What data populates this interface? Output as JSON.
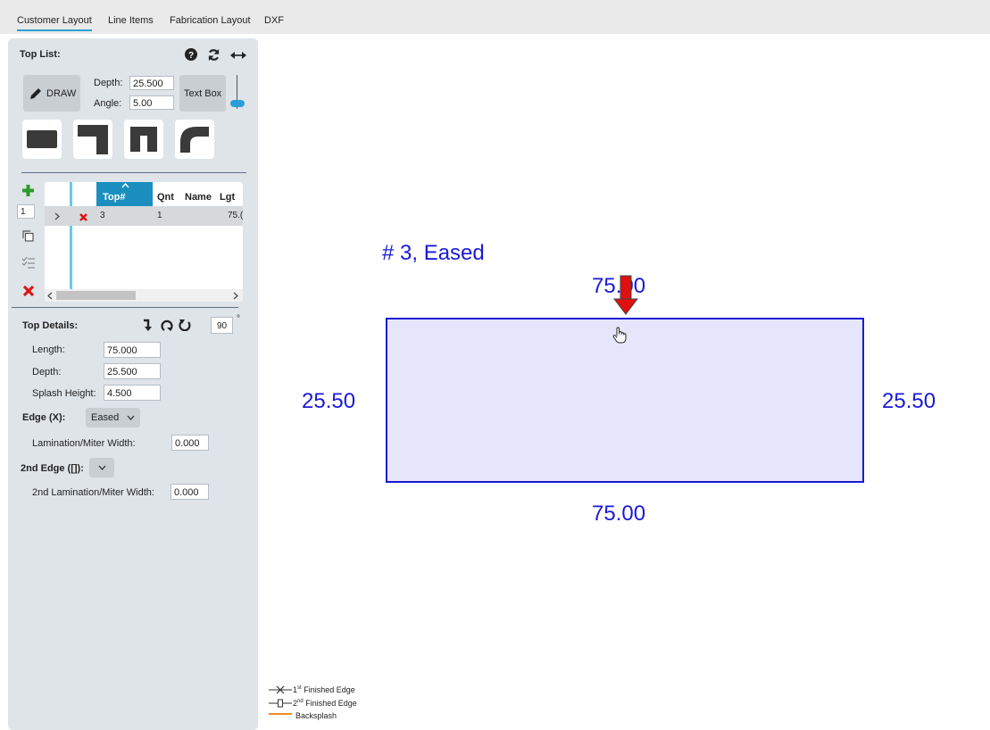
{
  "tabs": [
    {
      "label": "Customer Layout",
      "active": true
    },
    {
      "label": "Line Items"
    },
    {
      "label": "Fabrication Layout"
    },
    {
      "label": "DXF"
    }
  ],
  "top_list": {
    "title": "Top List:",
    "draw_label": "DRAW",
    "depth_label": "Depth:",
    "depth_value": "25.500",
    "angle_label": "Angle:",
    "angle_value": "5.00",
    "textbox_label": "Text Box"
  },
  "grid": {
    "qty_input": "1",
    "columns": [
      "Top#",
      "Qnt",
      "Name",
      "Lgt"
    ],
    "rows": [
      {
        "top": "3",
        "qnt": "1",
        "name": "",
        "lgt": "75.("
      }
    ]
  },
  "top_details": {
    "title": "Top Details:",
    "rotate_value": "90",
    "degree_symbol": "°",
    "length_label": "Length:",
    "length_value": "75.000",
    "depth_label": "Depth:",
    "depth_value": "25.500",
    "splash_label": "Splash Height:",
    "splash_value": "4.500",
    "edge_label": "Edge (X):",
    "edge_value": "Eased",
    "lam_label": "Lamination/Miter Width:",
    "lam_value": "0.000",
    "edge2_label": "2nd Edge ([]):",
    "edge2_value": "",
    "lam2_label": "2nd Lamination/Miter Width:",
    "lam2_value": "0.000"
  },
  "canvas": {
    "title": "# 3, Eased",
    "top_dim": "75.00",
    "bottom_dim": "75.00",
    "left_dim": "25.50",
    "right_dim": "25.50",
    "rect_fill": "#e6e6fa",
    "rect_stroke": "#1a1ad6",
    "arrow_color": "#e01010"
  },
  "legend": {
    "first_sup": "st",
    "first_text": "Finished Edge",
    "second_sup": "nd",
    "second_text": "Finished Edge",
    "backsplash": "Backsplash",
    "first_num": "1",
    "second_num": "2"
  }
}
